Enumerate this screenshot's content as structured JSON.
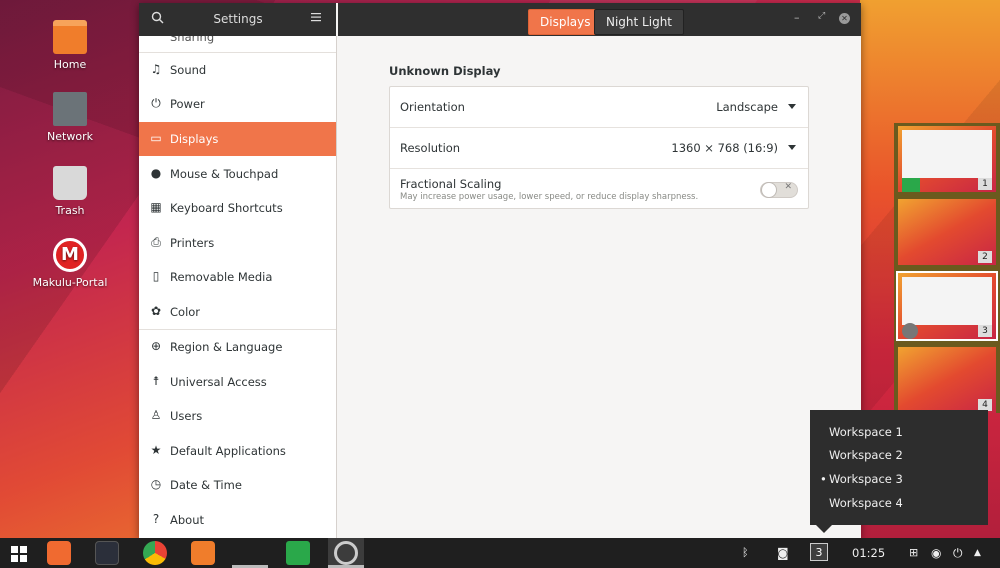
{
  "desktop": {
    "icons": [
      {
        "label": "Home"
      },
      {
        "label": "Network"
      },
      {
        "label": "Trash"
      },
      {
        "label": "Makulu-Portal",
        "glyph": "M"
      }
    ]
  },
  "window": {
    "title": "Settings",
    "tabs": [
      {
        "label": "Displays",
        "active": true
      },
      {
        "label": "Night Light",
        "active": false
      }
    ],
    "controls": {
      "minimize": "–",
      "maximize": "⤢",
      "close": "✕"
    }
  },
  "sidebar": {
    "partial_item": "Sharing",
    "items": [
      {
        "label": "Sound",
        "icon": "music-note-icon",
        "glyph": "♫"
      },
      {
        "label": "Power",
        "icon": "power-icon",
        "glyph": "⏻"
      },
      {
        "label": "Displays",
        "icon": "display-icon",
        "glyph": "▭",
        "active": true
      },
      {
        "label": "Mouse & Touchpad",
        "icon": "mouse-icon",
        "glyph": "●"
      },
      {
        "label": "Keyboard Shortcuts",
        "icon": "keyboard-icon",
        "glyph": "▦"
      },
      {
        "label": "Printers",
        "icon": "printer-icon",
        "glyph": "⎙"
      },
      {
        "label": "Removable Media",
        "icon": "phone-icon",
        "glyph": "▯"
      },
      {
        "label": "Color",
        "icon": "color-icon",
        "glyph": "✿"
      },
      {
        "label": "Region & Language",
        "icon": "globe-icon",
        "glyph": "⊕"
      },
      {
        "label": "Universal Access",
        "icon": "accessibility-icon",
        "glyph": "☨"
      },
      {
        "label": "Users",
        "icon": "user-icon",
        "glyph": "♙"
      },
      {
        "label": "Default Applications",
        "icon": "star-icon",
        "glyph": "★"
      },
      {
        "label": "Date & Time",
        "icon": "clock-icon",
        "glyph": "◷"
      },
      {
        "label": "About",
        "icon": "help-icon",
        "glyph": "?"
      }
    ]
  },
  "display": {
    "section_title": "Unknown Display",
    "orientation": {
      "label": "Orientation",
      "value": "Landscape"
    },
    "resolution": {
      "label": "Resolution",
      "value": "1360 × 768 (16:9)"
    },
    "fractional_scaling": {
      "label": "Fractional Scaling",
      "description": "May increase power usage, lower speed, or reduce display sharpness.",
      "enabled": false,
      "off_glyph": "✕"
    }
  },
  "workspace_pager": {
    "numbers": [
      "1",
      "2",
      "3",
      "4"
    ],
    "current": "3"
  },
  "workspace_popup": {
    "options": [
      "Workspace 1",
      "Workspace 2",
      "Workspace 3",
      "Workspace 4"
    ],
    "selected_index": 2,
    "bullet": "•"
  },
  "taskbar": {
    "clock": "01:25",
    "workspace_indicator": "3",
    "tray_glyphs": {
      "bluetooth": "ᛒ",
      "record": "◙",
      "network": "⊞",
      "status": "◉",
      "power": "⏻",
      "arrow": "▲"
    }
  },
  "colors": {
    "accent": "#f0754a",
    "headerbar": "#2f2f2f",
    "sidebar_bg": "#ffffff",
    "content_bg": "#f6f5f4"
  }
}
